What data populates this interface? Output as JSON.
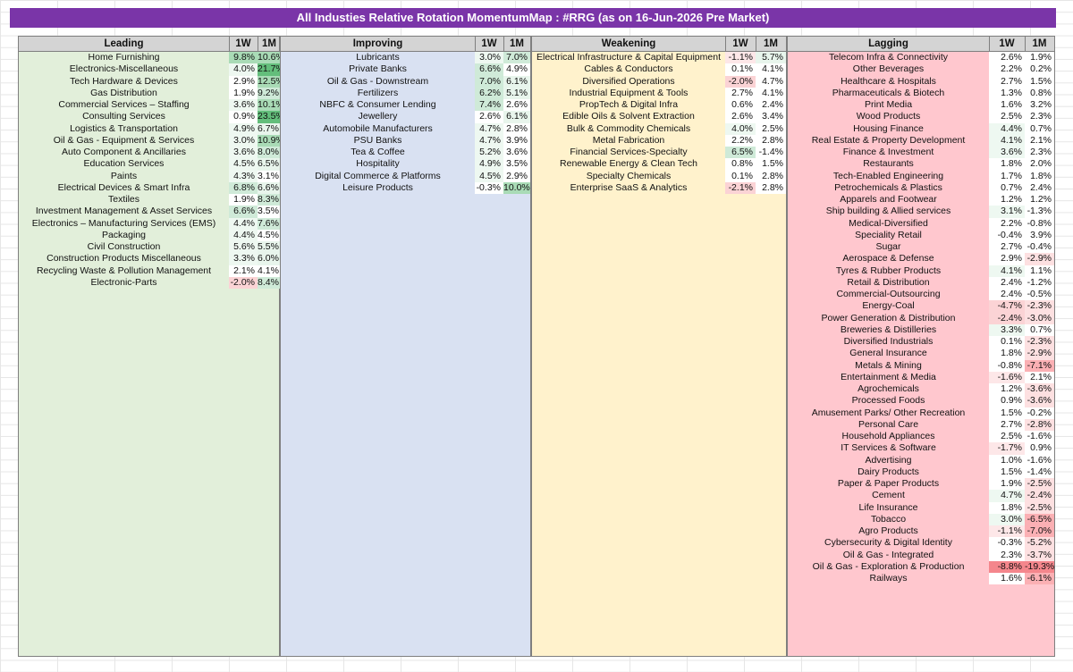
{
  "title": "All Industies Relative Rotation MomentumMap : #RRG (as on 16-Jun-2026 Pre Market)",
  "col_headers": {
    "w1": "1W",
    "m1": "1M"
  },
  "colors": {
    "leading_bg": "#e2efda",
    "improving_bg": "#d9e1f2",
    "weakening_bg": "#fff2cc",
    "lagging_bg": "#ffc7ce",
    "header_bg": "#d4d4d4",
    "title_bg": "#7a35a8"
  },
  "leading": {
    "label": "Leading",
    "rows": [
      [
        "Home Furnishing",
        "9.8%",
        "10.6%"
      ],
      [
        "Electronics-Miscellaneous",
        "4.0%",
        "21.7%"
      ],
      [
        "Tech Hardware & Devices",
        "2.9%",
        "12.5%"
      ],
      [
        "Gas Distribution",
        "1.9%",
        "9.2%"
      ],
      [
        "Commercial Services – Staffing",
        "3.6%",
        "10.1%"
      ],
      [
        "Consulting Services",
        "0.9%",
        "23.5%"
      ],
      [
        "Logistics & Transportation",
        "4.9%",
        "6.7%"
      ],
      [
        "Oil & Gas - Equipment & Services",
        "3.0%",
        "10.9%"
      ],
      [
        "Auto Component & Ancillaries",
        "3.6%",
        "8.0%"
      ],
      [
        "Education Services",
        "4.5%",
        "6.5%"
      ],
      [
        "Paints",
        "4.3%",
        "3.1%"
      ],
      [
        "Electrical Devices & Smart Infra",
        "6.8%",
        "6.6%"
      ],
      [
        "Textiles",
        "1.9%",
        "8.3%"
      ],
      [
        "Investment Management & Asset Services",
        "6.6%",
        "3.5%"
      ],
      [
        "Electronics – Manufacturing Services (EMS)",
        "4.4%",
        "7.6%"
      ],
      [
        "Packaging",
        "4.4%",
        "4.5%"
      ],
      [
        "Civil Construction",
        "5.6%",
        "5.5%"
      ],
      [
        "Construction Products Miscellaneous",
        "3.3%",
        "6.0%"
      ],
      [
        "Recycling Waste & Pollution Management",
        "2.1%",
        "4.1%"
      ],
      [
        "Electronic-Parts",
        "-2.0%",
        "8.4%"
      ]
    ]
  },
  "improving": {
    "label": "Improving",
    "rows": [
      [
        "Lubricants",
        "3.0%",
        "7.0%"
      ],
      [
        "Private Banks",
        "6.6%",
        "4.9%"
      ],
      [
        "Oil & Gas - Downstream",
        "7.0%",
        "6.1%"
      ],
      [
        "Fertilizers",
        "6.2%",
        "5.1%"
      ],
      [
        "NBFC & Consumer Lending",
        "7.4%",
        "2.6%"
      ],
      [
        "Jewellery",
        "2.6%",
        "6.1%"
      ],
      [
        "Automobile Manufacturers",
        "4.7%",
        "2.8%"
      ],
      [
        "PSU Banks",
        "4.7%",
        "3.9%"
      ],
      [
        "Tea & Coffee",
        "5.2%",
        "3.6%"
      ],
      [
        "Hospitality",
        "4.9%",
        "3.5%"
      ],
      [
        "Digital Commerce & Platforms",
        "4.5%",
        "2.9%"
      ],
      [
        "Leisure Products",
        "-0.3%",
        "10.0%"
      ]
    ]
  },
  "weakening": {
    "label": "Weakening",
    "rows": [
      [
        "Electrical Infrastructure & Capital Equipment",
        "-1.1%",
        "5.7%"
      ],
      [
        "Cables & Conductors",
        "0.1%",
        "4.1%"
      ],
      [
        "Diversified Operations",
        "-2.0%",
        "4.7%"
      ],
      [
        "Industrial Equipment & Tools",
        "2.7%",
        "4.1%"
      ],
      [
        "PropTech & Digital Infra",
        "0.6%",
        "2.4%"
      ],
      [
        "Edible Oils & Solvent Extraction",
        "2.6%",
        "3.4%"
      ],
      [
        "Bulk & Commodity Chemicals",
        "4.0%",
        "2.5%"
      ],
      [
        "Metal Fabrication",
        "2.2%",
        "2.8%"
      ],
      [
        "Financial Services-Specialty",
        "6.5%",
        "-1.4%"
      ],
      [
        "Renewable Energy & Clean Tech",
        "0.8%",
        "1.5%"
      ],
      [
        "Specialty Chemicals",
        "0.1%",
        "2.8%"
      ],
      [
        "Enterprise SaaS & Analytics",
        "-2.1%",
        "2.8%"
      ]
    ]
  },
  "lagging": {
    "label": "Lagging",
    "rows": [
      [
        "Telecom Infra & Connectivity",
        "2.6%",
        "1.9%"
      ],
      [
        "Other Beverages",
        "2.2%",
        "0.2%"
      ],
      [
        "Healthcare & Hospitals",
        "2.7%",
        "1.5%"
      ],
      [
        "Pharmaceuticals & Biotech",
        "1.3%",
        "0.8%"
      ],
      [
        "Print Media",
        "1.6%",
        "3.2%"
      ],
      [
        "Wood Products",
        "2.5%",
        "2.3%"
      ],
      [
        "Housing Finance",
        "4.4%",
        "0.7%"
      ],
      [
        "Real Estate & Property Development",
        "4.1%",
        "2.1%"
      ],
      [
        "Finance & Investment",
        "3.6%",
        "2.3%"
      ],
      [
        "Restaurants",
        "1.8%",
        "2.0%"
      ],
      [
        "Tech-Enabled Engineering",
        "1.7%",
        "1.8%"
      ],
      [
        "Petrochemicals & Plastics",
        "0.7%",
        "2.4%"
      ],
      [
        "Apparels and Footwear",
        "1.2%",
        "1.2%"
      ],
      [
        "Ship building & Allied services",
        "3.1%",
        "-1.3%"
      ],
      [
        "Medical-Diversified",
        "2.2%",
        "-0.8%"
      ],
      [
        "Speciality Retail",
        "-0.4%",
        "3.9%"
      ],
      [
        "Sugar",
        "2.7%",
        "-0.4%"
      ],
      [
        "Aerospace & Defense",
        "2.9%",
        "-2.9%"
      ],
      [
        "Tyres & Rubber Products",
        "4.1%",
        "1.1%"
      ],
      [
        "Retail & Distribution",
        "2.4%",
        "-1.2%"
      ],
      [
        "Commercial-Outsourcing",
        "2.4%",
        "-0.5%"
      ],
      [
        "Energy-Coal",
        "-4.7%",
        "-2.3%"
      ],
      [
        "Power Generation & Distribution",
        "-2.4%",
        "-3.0%"
      ],
      [
        "Breweries & Distilleries",
        "3.3%",
        "0.7%"
      ],
      [
        "Diversified Industrials",
        "0.1%",
        "-2.3%"
      ],
      [
        "General Insurance",
        "1.8%",
        "-2.9%"
      ],
      [
        "Metals & Mining",
        "-0.8%",
        "-7.1%"
      ],
      [
        "Entertainment & Media",
        "-1.6%",
        "2.1%"
      ],
      [
        "Agrochemicals",
        "1.2%",
        "-3.6%"
      ],
      [
        "Processed Foods",
        "0.9%",
        "-3.6%"
      ],
      [
        "Amusement Parks/ Other Recreation",
        "1.5%",
        "-0.2%"
      ],
      [
        "Personal Care",
        "2.7%",
        "-2.8%"
      ],
      [
        "Household Appliances",
        "2.5%",
        "-1.6%"
      ],
      [
        "IT Services & Software",
        "-1.7%",
        "0.9%"
      ],
      [
        "Advertising",
        "1.0%",
        "-1.6%"
      ],
      [
        "Dairy Products",
        "1.5%",
        "-1.4%"
      ],
      [
        "Paper & Paper Products",
        "1.9%",
        "-2.5%"
      ],
      [
        "Cement",
        "4.7%",
        "-2.4%"
      ],
      [
        "Life Insurance",
        "1.8%",
        "-2.5%"
      ],
      [
        "Tobacco",
        "3.0%",
        "-6.5%"
      ],
      [
        "Agro Products",
        "-1.1%",
        "-7.0%"
      ],
      [
        "Cybersecurity & Digital Identity",
        "-0.3%",
        "-5.2%"
      ],
      [
        "Oil & Gas - Integrated",
        "2.3%",
        "-3.7%"
      ],
      [
        "Oil & Gas - Exploration & Production",
        "-8.8%",
        "-19.3%"
      ],
      [
        "Railways",
        "1.6%",
        "-6.1%"
      ]
    ]
  }
}
